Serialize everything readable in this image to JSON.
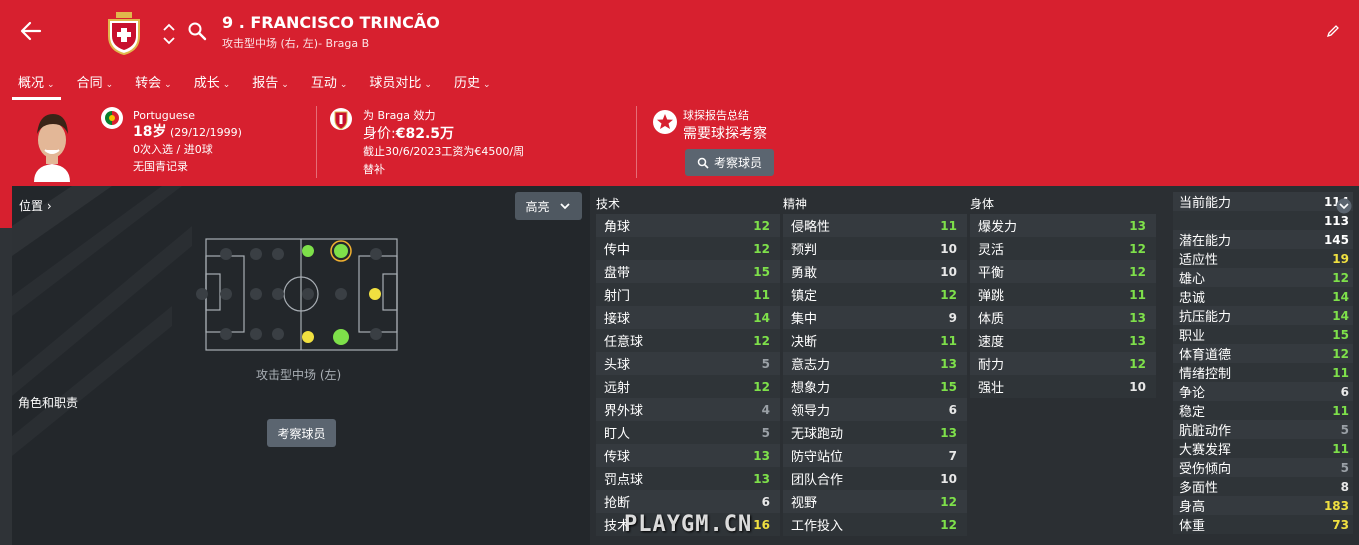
{
  "header": {
    "player_name": "9 . FRANCISCO TRINCÃO",
    "player_sub": "攻击型中场 (右, 左)- Braga B",
    "colors": {
      "header_bg": "#d7202f",
      "panel_bg": "#23272b"
    }
  },
  "tabs": [
    {
      "label": "概况"
    },
    {
      "label": "合同"
    },
    {
      "label": "转会"
    },
    {
      "label": "成长"
    },
    {
      "label": "报告"
    },
    {
      "label": "互动"
    },
    {
      "label": "球员对比"
    },
    {
      "label": "历史"
    }
  ],
  "info": {
    "nationality": "Portuguese",
    "age": "18岁",
    "dob": "(29/12/1999)",
    "caps": "0次入选 / 进0球",
    "youth": "无国青记录",
    "plays_for": "为 Braga 效力",
    "value_label": "身价:",
    "value": "€82.5万",
    "contract": "截止30/6/2023工资为€4500/周",
    "squad_status": "替补",
    "scout_title": "球探报告总结",
    "scout_need": "需要球探考察",
    "scout_button": "考察球员"
  },
  "left_panel": {
    "position_label": "位置",
    "highlight_button": "高亮",
    "position_name": "攻击型中场 (左)",
    "roles_label": "角色和职责",
    "scout_button": "考察球员"
  },
  "technical": {
    "title": "技术",
    "rows": [
      {
        "name": "角球",
        "value": "12",
        "color": "#7ee04a"
      },
      {
        "name": "传中",
        "value": "12",
        "color": "#7ee04a"
      },
      {
        "name": "盘带",
        "value": "15",
        "color": "#7ee04a"
      },
      {
        "name": "射门",
        "value": "11",
        "color": "#7ee04a"
      },
      {
        "name": "接球",
        "value": "14",
        "color": "#7ee04a"
      },
      {
        "name": "任意球",
        "value": "12",
        "color": "#7ee04a"
      },
      {
        "name": "头球",
        "value": "5",
        "color": "#9aa0a6"
      },
      {
        "name": "远射",
        "value": "12",
        "color": "#7ee04a"
      },
      {
        "name": "界外球",
        "value": "4",
        "color": "#9aa0a6"
      },
      {
        "name": "盯人",
        "value": "5",
        "color": "#9aa0a6"
      },
      {
        "name": "传球",
        "value": "13",
        "color": "#7ee04a"
      },
      {
        "name": "罚点球",
        "value": "13",
        "color": "#7ee04a"
      },
      {
        "name": "抢断",
        "value": "6",
        "color": "#e8e8e8"
      },
      {
        "name": "技术",
        "value": "16",
        "color": "#f0e040"
      }
    ]
  },
  "mental": {
    "title": "精神",
    "rows": [
      {
        "name": "侵略性",
        "value": "11",
        "color": "#7ee04a"
      },
      {
        "name": "预判",
        "value": "10",
        "color": "#e8e8e8"
      },
      {
        "name": "勇敢",
        "value": "10",
        "color": "#e8e8e8"
      },
      {
        "name": "镇定",
        "value": "12",
        "color": "#7ee04a"
      },
      {
        "name": "集中",
        "value": "9",
        "color": "#e8e8e8"
      },
      {
        "name": "决断",
        "value": "11",
        "color": "#7ee04a"
      },
      {
        "name": "意志力",
        "value": "13",
        "color": "#7ee04a"
      },
      {
        "name": "想象力",
        "value": "15",
        "color": "#7ee04a"
      },
      {
        "name": "领导力",
        "value": "6",
        "color": "#e8e8e8"
      },
      {
        "name": "无球跑动",
        "value": "13",
        "color": "#7ee04a"
      },
      {
        "name": "防守站位",
        "value": "7",
        "color": "#e8e8e8"
      },
      {
        "name": "团队合作",
        "value": "10",
        "color": "#e8e8e8"
      },
      {
        "name": "视野",
        "value": "12",
        "color": "#7ee04a"
      },
      {
        "name": "工作投入",
        "value": "12",
        "color": "#7ee04a"
      }
    ]
  },
  "physical": {
    "title": "身体",
    "rows": [
      {
        "name": "爆发力",
        "value": "13",
        "color": "#7ee04a"
      },
      {
        "name": "灵活",
        "value": "12",
        "color": "#7ee04a"
      },
      {
        "name": "平衡",
        "value": "12",
        "color": "#7ee04a"
      },
      {
        "name": "弹跳",
        "value": "11",
        "color": "#7ee04a"
      },
      {
        "name": "体质",
        "value": "13",
        "color": "#7ee04a"
      },
      {
        "name": "速度",
        "value": "13",
        "color": "#7ee04a"
      },
      {
        "name": "耐力",
        "value": "12",
        "color": "#7ee04a"
      },
      {
        "name": "强壮",
        "value": "10",
        "color": "#e8e8e8"
      }
    ]
  },
  "right_stats": [
    {
      "name": "当前能力",
      "value": "114",
      "color": "#ffffff"
    },
    {
      "name": "",
      "value": "113",
      "color": "#ffffff"
    },
    {
      "name": "潜在能力",
      "value": "145",
      "color": "#ffffff"
    },
    {
      "name": "适应性",
      "value": "19",
      "color": "#f0e040"
    },
    {
      "name": "雄心",
      "value": "12",
      "color": "#7ee04a"
    },
    {
      "name": "忠诚",
      "value": "14",
      "color": "#7ee04a"
    },
    {
      "name": "抗压能力",
      "value": "14",
      "color": "#7ee04a"
    },
    {
      "name": "职业",
      "value": "15",
      "color": "#7ee04a"
    },
    {
      "name": "体育道德",
      "value": "12",
      "color": "#7ee04a"
    },
    {
      "name": "情绪控制",
      "value": "11",
      "color": "#7ee04a"
    },
    {
      "name": "争论",
      "value": "6",
      "color": "#e8e8e8"
    },
    {
      "name": "稳定",
      "value": "11",
      "color": "#7ee04a"
    },
    {
      "name": "肮脏动作",
      "value": "5",
      "color": "#9aa0a6"
    },
    {
      "name": "大赛发挥",
      "value": "11",
      "color": "#7ee04a"
    },
    {
      "name": "受伤倾向",
      "value": "5",
      "color": "#9aa0a6"
    },
    {
      "name": "多面性",
      "value": "8",
      "color": "#e8e8e8"
    },
    {
      "name": "身高",
      "value": "183",
      "color": "#f0e040"
    },
    {
      "name": "体重",
      "value": "73",
      "color": "#f0e040"
    }
  ],
  "watermark": "PLAYGM.CN"
}
